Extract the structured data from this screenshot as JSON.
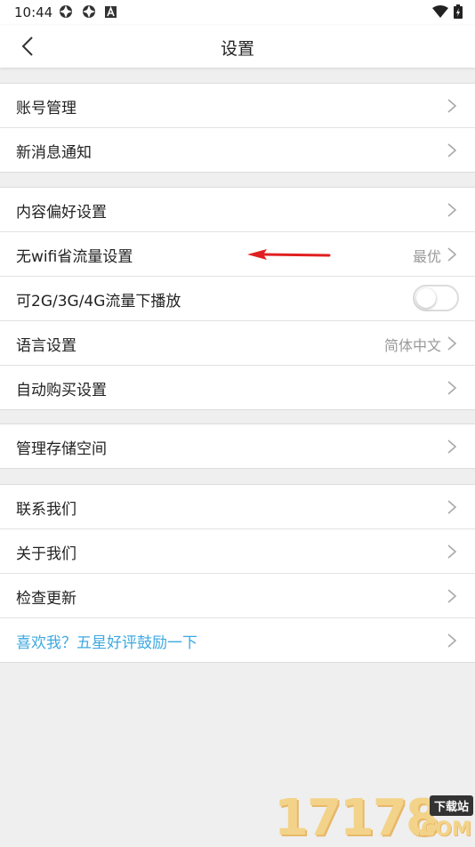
{
  "status_bar": {
    "time": "10:44"
  },
  "header": {
    "title": "设置"
  },
  "groups": [
    {
      "items": [
        {
          "label": "账号管理"
        },
        {
          "label": "新消息通知"
        }
      ]
    },
    {
      "items": [
        {
          "label": "内容偏好设置"
        },
        {
          "label": "无wifi省流量设置",
          "value": "最优"
        },
        {
          "label": "可2G/3G/4G流量下播放",
          "toggle": false
        },
        {
          "label": "语言设置",
          "value": "简体中文"
        },
        {
          "label": "自动购买设置"
        }
      ]
    },
    {
      "items": [
        {
          "label": "管理存储空间"
        }
      ]
    },
    {
      "items": [
        {
          "label": "联系我们"
        },
        {
          "label": "关于我们"
        },
        {
          "label": "检查更新"
        },
        {
          "label": "喜欢我？五星好评鼓励一下",
          "link": true
        }
      ]
    }
  ],
  "watermark": {
    "digits": "17178",
    "tag": "下载站",
    "suffix": ".COM"
  },
  "colors": {
    "link": "#3fa9e0",
    "arrow": "#e02020",
    "background": "#efefef"
  }
}
